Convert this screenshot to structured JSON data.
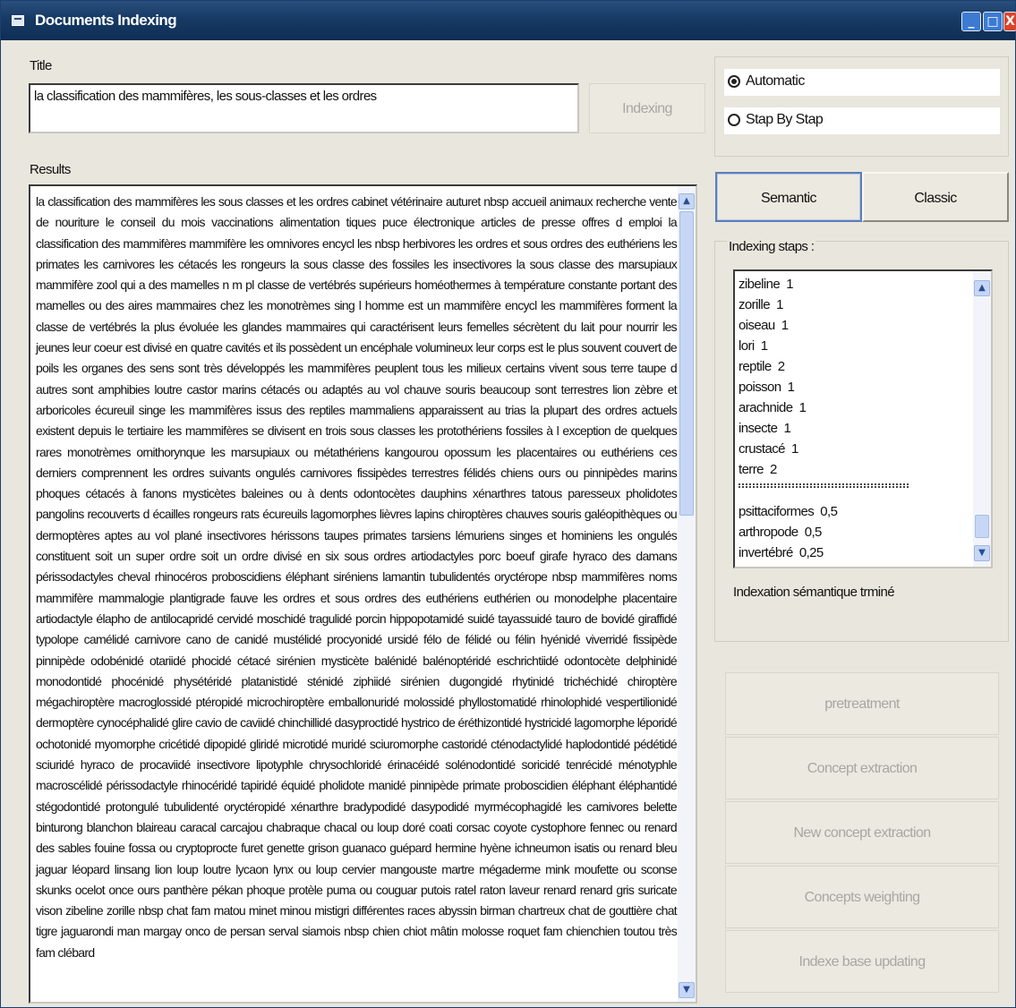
{
  "window": {
    "title": "Documents Indexing",
    "controls": {
      "minimize": "_",
      "maximize": "□",
      "close": "X"
    }
  },
  "title_field": {
    "label": "Title",
    "value": "la classification des mammifères, les sous-classes et les ordres"
  },
  "indexing_button": {
    "label": "Indexing",
    "enabled": false
  },
  "results": {
    "label": "Results",
    "text": "la classification des mammifères les sous classes et les ordres cabinet vétérinaire auturet nbsp accueil animaux recherche vente de nouriture le conseil du mois vaccinations alimentation tiques puce électronique articles de presse offres d emploi la classification des mammifères mammifère les omnivores encycl les nbsp herbivores les ordres et sous ordres des euthériens les primates les carnivores les cétacés les rongeurs la sous classe des fossiles les insectivores la sous classe des marsupiaux mammifère zool qui a des mamelles n m pl classe de vertébrés supérieurs homéothermes à température constante portant des mamelles ou des aires mammaires chez les monotrèmes sing l homme est un mammifère encycl les mammifères forment la classe de vertébrés la plus évoluée les glandes mammaires qui caractérisent leurs femelles sécrètent du lait pour nourrir les jeunes leur coeur est divisé en quatre cavités et ils possèdent un encéphale volumineux leur corps est le plus souvent couvert de poils les organes des sens sont très développés les mammifères peuplent tous les milieux certains vivent sous terre taupe d autres sont amphibies loutre castor marins cétacés ou adaptés au vol chauve souris beaucoup sont terrestres lion zèbre et arboricoles écureuil singe les mammifères issus des reptiles mammaliens apparaissent au trias la plupart des ordres actuels existent depuis le tertiaire les mammifères se divisent en trois sous classes les protothériens fossiles à l exception de quelques rares monotrèmes ornithorynque les marsupiaux ou métathériens kangourou opossum les placentaires ou euthériens ces derniers comprennent les ordres suivants ongulés carnivores fissipèdes terrestres félidés chiens ours ou pinnipèdes marins phoques cétacés à fanons mysticètes baleines ou à dents odontocètes dauphins xénarthres tatous paresseux pholidotes pangolins recouverts d écailles rongeurs rats écureuils lagomorphes lièvres lapins chiroptères chauves souris galéopithèques ou dermoptères aptes au vol plané insectivores hérissons taupes primates tarsiens lémuriens singes et hominiens les ongulés constituent soit un super ordre soit un ordre divisé en six sous ordres artiodactyles porc boeuf girafe hyraco des damans périssodactyles cheval rhinocéros proboscidiens éléphant siréniens lamantin tubulidentés oryctérope nbsp mammifères noms mammifère mammalogie plantigrade fauve les ordres et sous ordres des euthériens euthérien ou monodelphe placentaire artiodactyle élapho de antilocapridé cervidé moschidé tragulidé porcin hippopotamidé suidé tayassuidé tauro de bovidé giraffidé typolope camélidé carnivore cano de canidé mustélidé procyonidé ursidé félo de félidé ou félin hyénidé viverridé fissipède pinnipède odobénidé otariidé phocidé cétacé sirénien mysticète balénidé balénoptéridé eschrichtiidé odontocète delphinidé monodontidé phocénidé physétéridé platanistidé sténidé ziphiidé sirénien dugongidé rhytinidé trichéchidé chiroptère mégachiroptère macroglossidé ptéropidé microchiroptère emballonuridé molossidé phyllostomatidé rhinolophidé vespertilionidé dermoptère cynocéphalidé glire cavio de caviidé chinchillidé dasyproctidé hystrico de éréthizontidé hystricidé lagomorphe léporidé ochotonidé myomorphe cricétidé dipopidé gliridé microtidé muridé sciuromorphe castoridé cténodactylidé haplodontidé pédétidé sciuridé hyraco de procaviidé insectivore lipotyphle chrysochloridé érinacéidé solénodontidé soricidé tenrécidé ménotyphle macroscélidé périssodactyle rhinocéridé tapiridé équidé pholidote manidé pinnipède primate proboscidien éléphant éléphantidé stégodontidé protongulé tubulidenté oryctéropidé xénarthre bradypodidé dasypodidé myrmécophagidé les carnivores belette binturong blanchon blaireau caracal carcajou chabraque chacal ou loup doré coati corsac coyote cystophore fennec ou renard des sables fouine fossa ou cryptoprocte furet genette grison guanaco guépard hermine hyène ichneumon isatis ou renard bleu jaguar léopard linsang lion loup loutre lycaon lynx ou loup cervier mangouste martre mégaderme mink moufette ou sconse skunks ocelot once ours panthère pékan phoque protèle puma ou couguar putois ratel raton laveur renard renard gris suricate vison zibeline zorille nbsp chat fam matou minet minou mistigri différentes races abyssin birman chartreux chat de gouttière chat tigre jaguarondi man margay onco de persan serval siamois nbsp chien chiot mâtin molosse roquet fam chienchien toutou très fam clébard"
  },
  "mode": {
    "options": [
      {
        "label": "Automatic",
        "selected": true
      },
      {
        "label": "Stap By Stap",
        "selected": false
      }
    ]
  },
  "tabs": [
    {
      "label": "Semantic",
      "active": true
    },
    {
      "label": "Classic",
      "active": false
    }
  ],
  "indexing_steps": {
    "label": "Indexing staps :",
    "items": [
      {
        "term": "zibeline",
        "weight": "1"
      },
      {
        "term": "zorille",
        "weight": "1"
      },
      {
        "term": "oiseau",
        "weight": "1"
      },
      {
        "term": "lori",
        "weight": "1"
      },
      {
        "term": "reptile",
        "weight": "2"
      },
      {
        "term": "poisson",
        "weight": "1"
      },
      {
        "term": "arachnide",
        "weight": "1"
      },
      {
        "term": "insecte",
        "weight": "1"
      },
      {
        "term": "crustacé",
        "weight": "1"
      },
      {
        "term": "terre",
        "weight": "2"
      }
    ],
    "separator": "**********************************************",
    "weighted_items": [
      {
        "term": "psittaciformes",
        "weight": "0,5"
      },
      {
        "term": "arthropode",
        "weight": "0,5"
      },
      {
        "term": "invertébré",
        "weight": "0,25"
      }
    ],
    "status": "Indexation sémantique trminé"
  },
  "process_buttons": [
    {
      "label": "pretreatment",
      "enabled": false
    },
    {
      "label": "Concept extraction",
      "enabled": false
    },
    {
      "label": "New concept extraction",
      "enabled": false
    },
    {
      "label": "Concepts weighting",
      "enabled": false
    },
    {
      "label": "Indexe base updating",
      "enabled": false
    }
  ]
}
